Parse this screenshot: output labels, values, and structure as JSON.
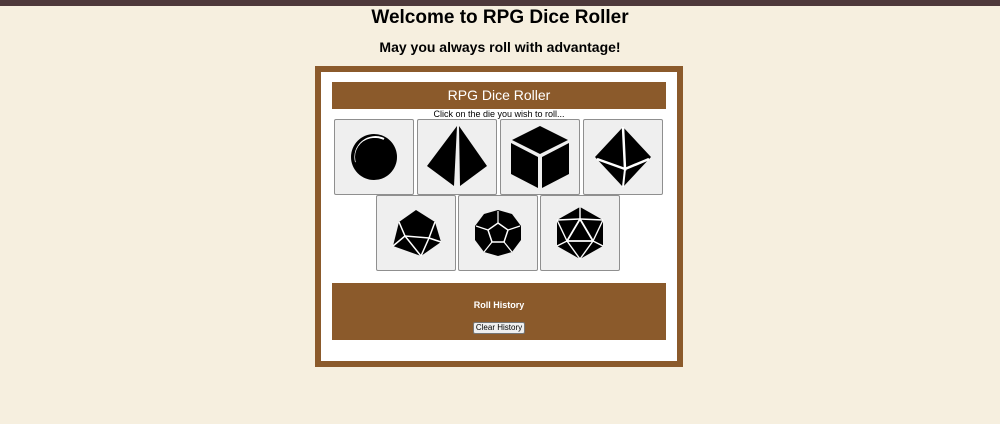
{
  "page": {
    "title": "Welcome to RPG Dice Roller",
    "subtitle": "May you always roll with advantage!"
  },
  "app": {
    "header": "RPG Dice Roller",
    "instruction": "Click on the die you wish to roll...",
    "dice": [
      {
        "name": "d2-coin-icon"
      },
      {
        "name": "d4-icon"
      },
      {
        "name": "d6-icon"
      },
      {
        "name": "d8-icon"
      },
      {
        "name": "d10-icon"
      },
      {
        "name": "d12-icon"
      },
      {
        "name": "d20-icon"
      }
    ],
    "history": {
      "title": "Roll History",
      "clear_label": "Clear History"
    }
  },
  "colors": {
    "background": "#f6efdf",
    "top_bar": "#4e393b",
    "accent_brown": "#8b5a2b",
    "panel": "#ffffff"
  }
}
